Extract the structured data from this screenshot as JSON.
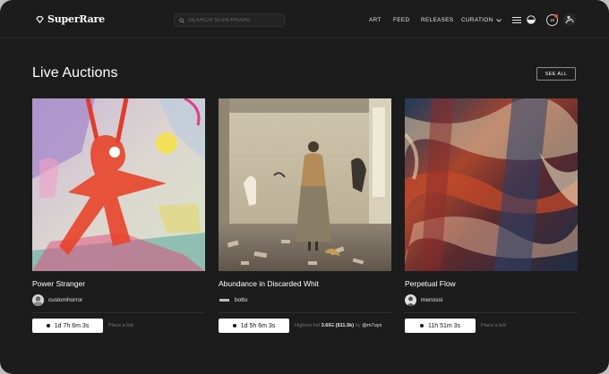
{
  "header": {
    "logo_text": "SuperRare",
    "search_placeholder": "SEARCH SUPERRARE",
    "nav": [
      "ART",
      "FEED",
      "RELEASES",
      "CURATION"
    ],
    "notification_count": "18"
  },
  "section": {
    "title": "Live Auctions",
    "see_all": "SEE ALL"
  },
  "cards": [
    {
      "title": "Power Stranger",
      "artist": "customhorror",
      "timer": "1d 7h 6m 3s",
      "bid_text": "Place a bid"
    },
    {
      "title": "Abundance in Discarded Whit",
      "artist": "botto",
      "timer": "1d 5h 6m 3s",
      "bid_label": "Highest bid",
      "bid_amount": "3.69Ξ",
      "bid_usd": "($11.5k)",
      "bid_by": "by",
      "bidder": "@m7uys"
    },
    {
      "title": "Perpetual Flow",
      "artist": "menossi",
      "timer": "11h 51m 3s",
      "bid_text": "Place a bid"
    }
  ],
  "colors": {
    "background": "#1c1c1c",
    "text": "#ffffff",
    "muted": "#757575",
    "timer_bg": "#ffffff"
  }
}
